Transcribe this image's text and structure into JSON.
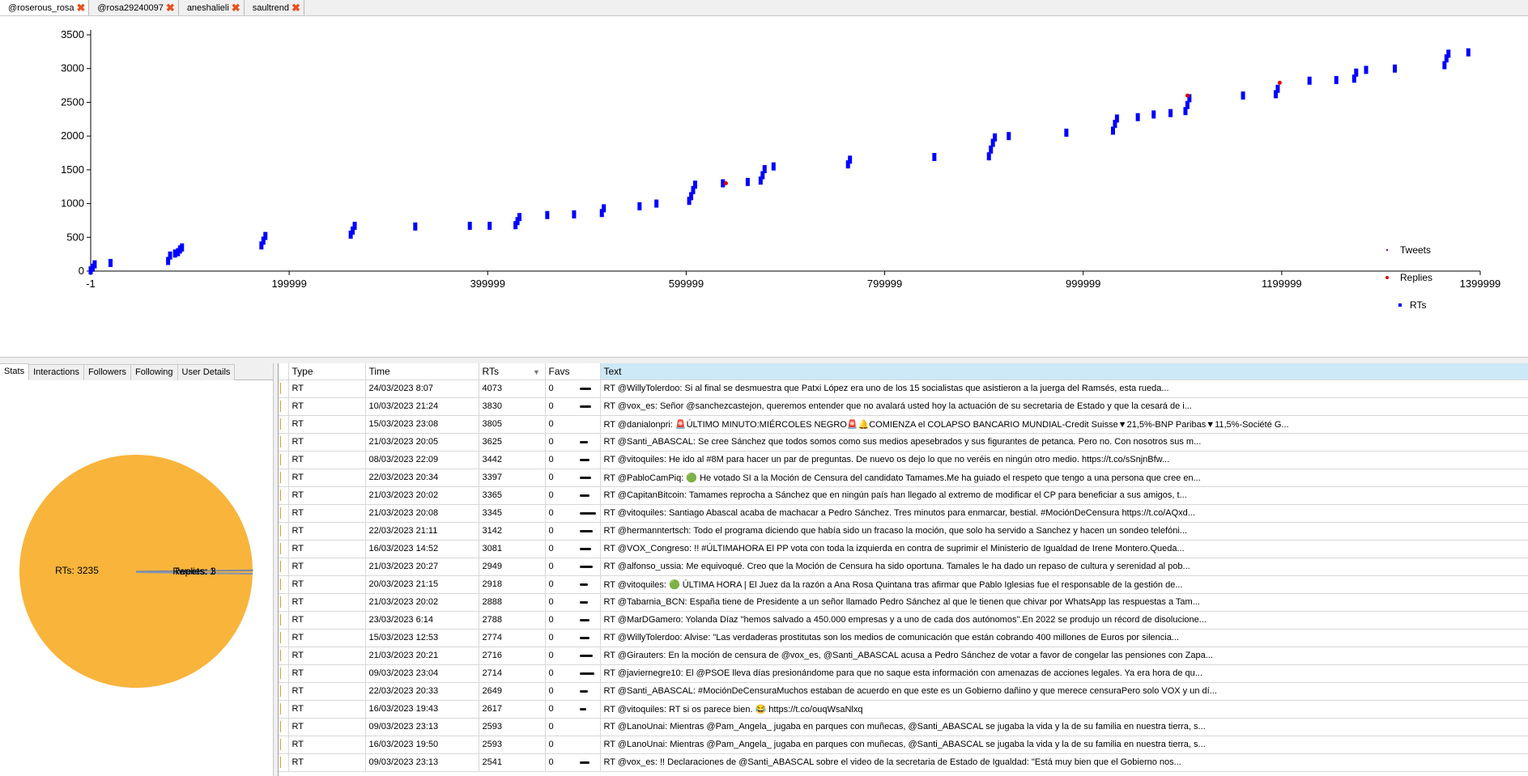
{
  "tabs": [
    {
      "label": "@roserous_rosa",
      "active": true
    },
    {
      "label": "@rosa29240097",
      "active": false
    },
    {
      "label": "aneshalieli",
      "active": false
    },
    {
      "label": "saultrend",
      "active": false
    }
  ],
  "close_icon": "✖",
  "chart_data": {
    "type": "scatter",
    "title": "",
    "xlabel": "",
    "ylabel": "",
    "xlim": [
      -1,
      1400000
    ],
    "ylim": [
      0,
      3500
    ],
    "x_ticks": [
      "-1",
      "199999",
      "399999",
      "599999",
      "799999",
      "999999",
      "1199999",
      "1399999"
    ],
    "y_ticks": [
      "0",
      "500",
      "1000",
      "1500",
      "2000",
      "2500",
      "3000",
      "3500"
    ],
    "legend_position": "right",
    "series": [
      {
        "name": "Tweets",
        "color": "#8b008b",
        "marker": "dot",
        "points": []
      },
      {
        "name": "Replies",
        "color": "#e00000",
        "marker": "dot",
        "points": [
          [
            640000,
            1300
          ],
          [
            1105000,
            2600
          ],
          [
            1198000,
            2790
          ]
        ]
      },
      {
        "name": "RTs",
        "color": "#0000ff",
        "marker": "square",
        "points": [
          [
            0,
            10
          ],
          [
            2000,
            50
          ],
          [
            4000,
            100
          ],
          [
            20000,
            120
          ],
          [
            78000,
            150
          ],
          [
            80000,
            230
          ],
          [
            85000,
            260
          ],
          [
            88000,
            280
          ],
          [
            90000,
            320
          ],
          [
            92000,
            350
          ],
          [
            172000,
            380
          ],
          [
            174000,
            450
          ],
          [
            176000,
            520
          ],
          [
            262000,
            540
          ],
          [
            264000,
            600
          ],
          [
            266000,
            670
          ],
          [
            327000,
            660
          ],
          [
            382000,
            670
          ],
          [
            402000,
            670
          ],
          [
            428000,
            680
          ],
          [
            430000,
            740
          ],
          [
            432000,
            800
          ],
          [
            460000,
            830
          ],
          [
            487000,
            840
          ],
          [
            515000,
            860
          ],
          [
            517000,
            930
          ],
          [
            553000,
            960
          ],
          [
            570000,
            1000
          ],
          [
            603000,
            1040
          ],
          [
            605000,
            1110
          ],
          [
            607000,
            1200
          ],
          [
            609000,
            1280
          ],
          [
            637000,
            1300
          ],
          [
            662000,
            1320
          ],
          [
            675000,
            1340
          ],
          [
            677000,
            1420
          ],
          [
            679000,
            1510
          ],
          [
            688000,
            1550
          ],
          [
            763000,
            1580
          ],
          [
            765000,
            1650
          ],
          [
            850000,
            1690
          ],
          [
            905000,
            1700
          ],
          [
            907000,
            1800
          ],
          [
            909000,
            1900
          ],
          [
            911000,
            1980
          ],
          [
            925000,
            2000
          ],
          [
            983000,
            2050
          ],
          [
            1030000,
            2080
          ],
          [
            1032000,
            2180
          ],
          [
            1034000,
            2260
          ],
          [
            1055000,
            2280
          ],
          [
            1071000,
            2320
          ],
          [
            1088000,
            2340
          ],
          [
            1103000,
            2370
          ],
          [
            1105000,
            2460
          ],
          [
            1107000,
            2560
          ],
          [
            1161000,
            2600
          ],
          [
            1194000,
            2620
          ],
          [
            1196000,
            2700
          ],
          [
            1228000,
            2820
          ],
          [
            1255000,
            2830
          ],
          [
            1273000,
            2850
          ],
          [
            1275000,
            2940
          ],
          [
            1285000,
            2980
          ],
          [
            1314000,
            3000
          ],
          [
            1364000,
            3050
          ],
          [
            1366000,
            3150
          ],
          [
            1368000,
            3220
          ],
          [
            1388000,
            3240
          ]
        ]
      }
    ]
  },
  "side_tabs": [
    {
      "label": "Stats",
      "active": true
    },
    {
      "label": "Interactions",
      "active": false
    },
    {
      "label": "Followers",
      "active": false
    },
    {
      "label": "Following",
      "active": false
    },
    {
      "label": "User Details",
      "active": false
    }
  ],
  "pie": {
    "slices": [
      {
        "label": "RTs: 3235",
        "value": 3235,
        "color": "#f9b43c"
      },
      {
        "label": "Replies: 3",
        "value": 3,
        "color": "#8090c0"
      },
      {
        "label": "Tweets: 1",
        "value": 1,
        "color": "#708090"
      }
    ]
  },
  "table": {
    "columns": [
      "Type",
      "Time",
      "RTs",
      "Favs",
      "Text"
    ],
    "sort_arrow": "▼",
    "rows": [
      {
        "type": "RT",
        "time": "24/03/2023 8:07",
        "rts": "4073",
        "favs": "0",
        "text": "RT @WillyTolerdoo: Si al final se desmuestra que Patxi López era uno de los 15 socialistas que asistieron a la juerga del Ramsés, esta rueda..."
      },
      {
        "type": "RT",
        "time": "10/03/2023 21:24",
        "rts": "3830",
        "favs": "0",
        "text": "RT @vox_es: Señor @sanchezcastejon, queremos entender que no avalará usted hoy la actuación de su secretaria de Estado y que la cesará de i..."
      },
      {
        "type": "RT",
        "time": "15/03/2023 23:08",
        "rts": "3805",
        "favs": "0",
        "text": "RT @danialonpri: 🚨ÚLTIMO MINUTO:MIÉRCOLES NEGRO🚨🔔COMIENZA el COLAPSO BANCARIO MUNDIAL-Credit Suisse▼21,5%-BNP Paribas▼11,5%-Société G..."
      },
      {
        "type": "RT",
        "time": "21/03/2023 20:05",
        "rts": "3625",
        "favs": "0",
        "text": "RT @Santi_ABASCAL: Se cree Sánchez que todos somos como sus medios apesebrados y sus figurantes de petanca. Pero no. Con nosotros sus m..."
      },
      {
        "type": "RT",
        "time": "08/03/2023 22:09",
        "rts": "3442",
        "favs": "0",
        "text": "RT @vitoquiles: He ido al #8M para hacer un par de preguntas. De nuevo os dejo lo que no veréis en ningún otro medio. https://t.co/sSnjnBfw..."
      },
      {
        "type": "RT",
        "time": "22/03/2023 20:34",
        "rts": "3397",
        "favs": "0",
        "text": "RT @PabloCamPiq: 🟢 He votado SI a la Moción de Censura del candidato Tamames.Me ha guiado el respeto que tengo a una persona que cree en..."
      },
      {
        "type": "RT",
        "time": "21/03/2023 20:02",
        "rts": "3365",
        "favs": "0",
        "text": "RT @CapitanBitcoin: Tamames reprocha a Sánchez que en ningún país han llegado al extremo de modificar el CP para beneficiar a sus amigos, t..."
      },
      {
        "type": "RT",
        "time": "21/03/2023 20:08",
        "rts": "3345",
        "favs": "0",
        "text": "RT @vitoquiles: Santiago Abascal acaba de machacar a Pedro Sánchez. Tres minutos para enmarcar, bestial. #MociónDeCensura https://t.co/AQxd..."
      },
      {
        "type": "RT",
        "time": "22/03/2023 21:11",
        "rts": "3142",
        "favs": "0",
        "text": "RT @hermanntertsch: Todo el programa diciendo que había sido un fracaso la moción, que solo ha servido a Sanchez y hacen un sondeo telefóni..."
      },
      {
        "type": "RT",
        "time": "16/03/2023 14:52",
        "rts": "3081",
        "favs": "0",
        "text": "RT @VOX_Congreso: !! #ÚLTIMAHORA El PP vota con toda la izquierda en contra de suprimir el Ministerio de Igualdad de Irene Montero.Queda..."
      },
      {
        "type": "RT",
        "time": "21/03/2023 20:27",
        "rts": "2949",
        "favs": "0",
        "text": "RT @alfonso_ussia: Me equivoqué. Creo que la Moción de Censura ha sido oportuna. Tamales le ha dado un repaso de cultura y serenidad al pob..."
      },
      {
        "type": "RT",
        "time": "20/03/2023 21:15",
        "rts": "2918",
        "favs": "0",
        "text": "RT @vitoquiles: 🟢 ÚLTIMA HORA | El Juez da la razón a Ana Rosa Quintana tras afirmar que Pablo Iglesias fue el responsable de la gestión de..."
      },
      {
        "type": "RT",
        "time": "21/03/2023 20:02",
        "rts": "2888",
        "favs": "0",
        "text": "RT @Tabarnia_BCN: España tiene de Presidente a un señor llamado Pedro Sánchez al que le tienen que chivar por WhatsApp las respuestas a Tam..."
      },
      {
        "type": "RT",
        "time": "23/03/2023 6:14",
        "rts": "2788",
        "favs": "0",
        "text": "RT @MarDGamero: Yolanda Díaz \"hemos salvado a 450.000 empresas y a uno de cada dos autónomos\".En 2022 se produjo un récord de disolucione..."
      },
      {
        "type": "RT",
        "time": "15/03/2023 12:53",
        "rts": "2774",
        "favs": "0",
        "text": "RT @WillyTolerdoo: Alvise: \"Las verdaderas prostitutas son los medios de comunicación que están cobrando 400 millones de Euros por silencia..."
      },
      {
        "type": "RT",
        "time": "21/03/2023 20:21",
        "rts": "2716",
        "favs": "0",
        "text": "RT @Girauters: En la moción de censura de @vox_es, @Santi_ABASCAL acusa a Pedro Sánchez de votar a favor de congelar las pensiones con Zapa..."
      },
      {
        "type": "RT",
        "time": "09/03/2023 23:04",
        "rts": "2714",
        "favs": "0",
        "text": "RT @javiernegre10: El @PSOE lleva días presionándome para que no saque esta información con amenazas de acciones legales. Ya era hora de qu..."
      },
      {
        "type": "RT",
        "time": "22/03/2023 20:33",
        "rts": "2649",
        "favs": "0",
        "text": "RT @Santi_ABASCAL: #MociónDeCensuraMuchos estaban de acuerdo en que este es un Gobierno dañino y que merece censuraPero solo VOX y un dí..."
      },
      {
        "type": "RT",
        "time": "16/03/2023 19:43",
        "rts": "2617",
        "favs": "0",
        "text": "RT @vitoquiles: RT si os parece bien. 😂 https://t.co/ouqWsaNlxq"
      },
      {
        "type": "RT",
        "time": "09/03/2023 23:13",
        "rts": "2593",
        "favs": "0",
        "text": "RT @LanoUnai: Mientras @Pam_Angela_ jugaba en parques con muñecas, @Santi_ABASCAL se jugaba la vida y la de su familia en nuestra tierra, s..."
      },
      {
        "type": "RT",
        "time": "16/03/2023 19:50",
        "rts": "2593",
        "favs": "0",
        "text": "RT @LanoUnai: Mientras @Pam_Angela_ jugaba en parques con muñecas, @Santi_ABASCAL se jugaba la vida y la de su familia en nuestra tierra, s..."
      },
      {
        "type": "RT",
        "time": "09/03/2023 23:13",
        "rts": "2541",
        "favs": "0",
        "text": "RT @vox_es: !! Declaraciones de @Santi_ABASCAL sobre el video de la secretaria de Estado de Igualdad:  \"Está muy bien que el Gobierno nos..."
      }
    ]
  }
}
